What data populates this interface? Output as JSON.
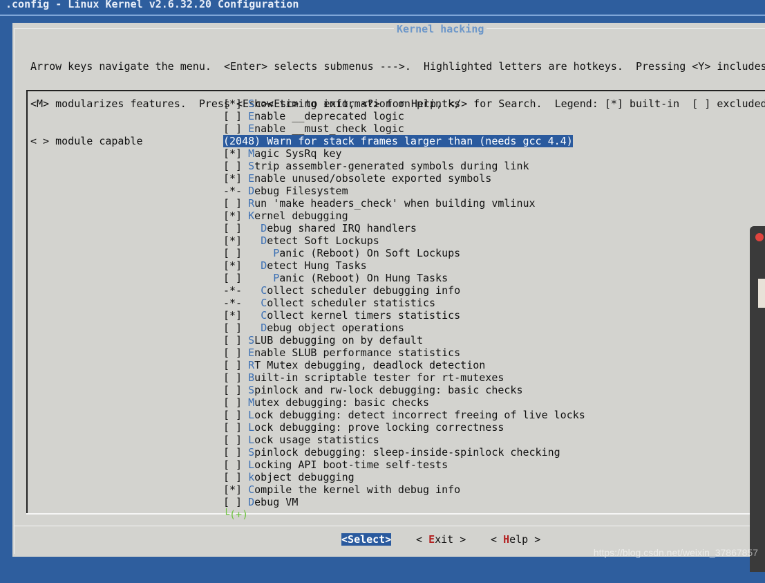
{
  "window": {
    "title": ".config - Linux Kernel v2.6.32.20 Configuration"
  },
  "dialog": {
    "title": "Kernel hacking",
    "help_lines": [
      "Arrow keys navigate the menu.  <Enter> selects submenus --->.  Highlighted letters are hotkeys.  Pressing <Y> includes",
      "<M> modularizes features.  Press <Esc><Esc> to exit, <?> for Help, </> for Search.  Legend: [*] built-in  [ ] excluded",
      "< > module capable"
    ]
  },
  "menu": {
    "items": [
      {
        "state": "[*] ",
        "indent": "",
        "hotkey": "S",
        "rest": "how timing information on printks"
      },
      {
        "state": "[ ] ",
        "indent": "",
        "hotkey": "E",
        "rest": "nable __deprecated logic"
      },
      {
        "state": "[ ] ",
        "indent": "",
        "hotkey": "E",
        "rest": "nable __must_check logic"
      },
      {
        "state": "(2048) ",
        "indent": "",
        "hotkey": "W",
        "rest": "arn for stack frames larger than (needs gcc 4.4)",
        "selected": true
      },
      {
        "state": "[*] ",
        "indent": "",
        "hotkey": "M",
        "rest": "agic SysRq key",
        "hk_pos": 1
      },
      {
        "state": "[ ] ",
        "indent": "",
        "hotkey": "S",
        "rest": "trip assembler-generated symbols during link"
      },
      {
        "state": "[*] ",
        "indent": "",
        "hotkey": "E",
        "rest": "nable unused/obsolete exported symbols"
      },
      {
        "state": "-*- ",
        "indent": "",
        "hotkey": "D",
        "rest": "ebug Filesystem"
      },
      {
        "state": "[ ] ",
        "indent": "",
        "hotkey": "R",
        "rest": "un 'make headers_check' when building vmlinux"
      },
      {
        "state": "[*] ",
        "indent": "",
        "hotkey": "K",
        "rest": "ernel debugging"
      },
      {
        "state": "[ ] ",
        "indent": "  ",
        "hotkey": "D",
        "rest": "ebug shared IRQ handlers"
      },
      {
        "state": "[*] ",
        "indent": "  ",
        "hotkey": "D",
        "rest": "etect Soft Lockups"
      },
      {
        "state": "[ ] ",
        "indent": "    ",
        "hotkey": "P",
        "rest": "anic (Reboot) On Soft Lockups"
      },
      {
        "state": "[*] ",
        "indent": "  ",
        "hotkey": "D",
        "rest": "etect Hung Tasks"
      },
      {
        "state": "[ ] ",
        "indent": "    ",
        "hotkey": "P",
        "rest": "anic (Reboot) On Hung Tasks"
      },
      {
        "state": "-*- ",
        "indent": "  ",
        "hotkey": "C",
        "rest": "ollect scheduler debugging info"
      },
      {
        "state": "-*- ",
        "indent": "  ",
        "hotkey": "C",
        "rest": "ollect scheduler statistics"
      },
      {
        "state": "[*] ",
        "indent": "  ",
        "hotkey": "C",
        "rest": "ollect kernel timers statistics"
      },
      {
        "state": "[ ] ",
        "indent": "  ",
        "hotkey": "D",
        "rest": "ebug object operations"
      },
      {
        "state": "[ ] ",
        "indent": "",
        "hotkey": "S",
        "rest": "LUB debugging on by default"
      },
      {
        "state": "[ ] ",
        "indent": "",
        "hotkey": "E",
        "rest": "nable SLUB performance statistics"
      },
      {
        "state": "[ ] ",
        "indent": "",
        "hotkey": "R",
        "rest": "T Mutex debugging, deadlock detection"
      },
      {
        "state": "[ ] ",
        "indent": "",
        "hotkey": "B",
        "rest": "uilt-in scriptable tester for rt-mutexes"
      },
      {
        "state": "[ ] ",
        "indent": "",
        "hotkey": "S",
        "rest": "pinlock and rw-lock debugging: basic checks"
      },
      {
        "state": "[ ] ",
        "indent": "",
        "hotkey": "M",
        "rest": "utex debugging: basic checks",
        "hk_pos": 1
      },
      {
        "state": "[ ] ",
        "indent": "",
        "hotkey": "L",
        "rest": "ock debugging: detect incorrect freeing of live locks"
      },
      {
        "state": "[ ] ",
        "indent": "",
        "hotkey": "L",
        "rest": "ock debugging: prove locking correctness"
      },
      {
        "state": "[ ] ",
        "indent": "",
        "hotkey": "L",
        "rest": "ock usage statistics"
      },
      {
        "state": "[ ] ",
        "indent": "",
        "hotkey": "S",
        "rest": "pinlock debugging: sleep-inside-spinlock checking"
      },
      {
        "state": "[ ] ",
        "indent": "",
        "hotkey": "L",
        "rest": "ocking API boot-time self-tests"
      },
      {
        "state": "[ ] ",
        "indent": "",
        "hotkey": "k",
        "rest": "object debugging"
      },
      {
        "state": "[*] ",
        "indent": "",
        "hotkey": "C",
        "rest": "ompile the kernel with debug info"
      },
      {
        "state": "[ ] ",
        "indent": "",
        "hotkey": "D",
        "rest": "ebug VM"
      }
    ],
    "more_indicator": "└(+)"
  },
  "buttons": {
    "select": {
      "left": "<",
      "hotkey": "S",
      "rest": "elect>"
    },
    "exit": {
      "left": "< ",
      "hotkey": "E",
      "rest": "xit >"
    },
    "help": {
      "left": "< ",
      "hotkey": "H",
      "rest": "elp >"
    }
  },
  "watermark": "https://blog.csdn.net/weixin_37867857",
  "colors": {
    "background": "#2e5e9e",
    "dialog": "#d3d3cf",
    "hotkey": "#3b6fb3",
    "selection": "#2a5a9e",
    "more_indicator": "#6fc442"
  }
}
